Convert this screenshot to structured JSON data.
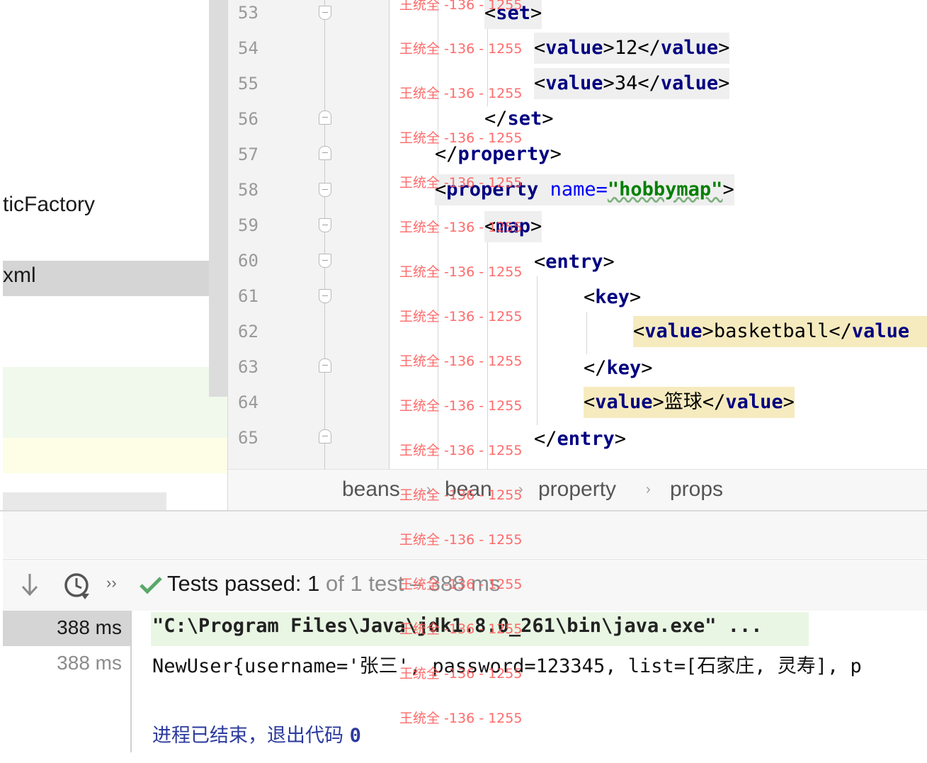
{
  "project_tree": {
    "item_factory": "ticFactory",
    "item_xml": "xml"
  },
  "editor": {
    "lines": [
      {
        "no": "53"
      },
      {
        "no": "54"
      },
      {
        "no": "55"
      },
      {
        "no": "56"
      },
      {
        "no": "57"
      },
      {
        "no": "58"
      },
      {
        "no": "59"
      },
      {
        "no": "60"
      },
      {
        "no": "61"
      },
      {
        "no": "62"
      },
      {
        "no": "63"
      },
      {
        "no": "64"
      },
      {
        "no": "65"
      }
    ],
    "code": {
      "l53_set": "set",
      "l54_val": "12",
      "l55_val": "34",
      "l56_set": "set",
      "l57_prop": "property",
      "l58_prop": "property",
      "l58_attr": "name",
      "l58_str": "\"hobbymap\"",
      "l59_map": "map",
      "l60_entry": "entry",
      "l61_key": "key",
      "l62_val": "basketball",
      "l62_tag": "value",
      "l63_key": "key",
      "l64_val": "篮球",
      "l65_entry": "entry",
      "value_tag": "value"
    },
    "watermark": "王统全 -136 - 1255"
  },
  "breadcrumb": [
    "beans",
    "bean",
    "property",
    "props"
  ],
  "breadcrumb_sep": "›",
  "test_toolbar": {
    "status_prefix": "Tests passed: ",
    "passed": "1",
    "of_text": " of 1 test",
    "duration": " – 388 ms",
    "more_glyph": "››"
  },
  "run": {
    "times": [
      "388 ms",
      "388 ms"
    ],
    "console": {
      "cmd": "\"C:\\Program Files\\Java\\jdk1.8.0_261\\bin\\java.exe\" ...",
      "output": "NewUser{username='张三', password=123345, list=[石家庄, 灵寿], p",
      "exit_prefix": "进程已结束，退出代码 ",
      "exit_code": "0"
    }
  },
  "colors": {
    "tag": "#000080",
    "attr": "#0000ff",
    "string": "#008000",
    "watermark": "#ff5a5a",
    "success": "#59a869"
  }
}
